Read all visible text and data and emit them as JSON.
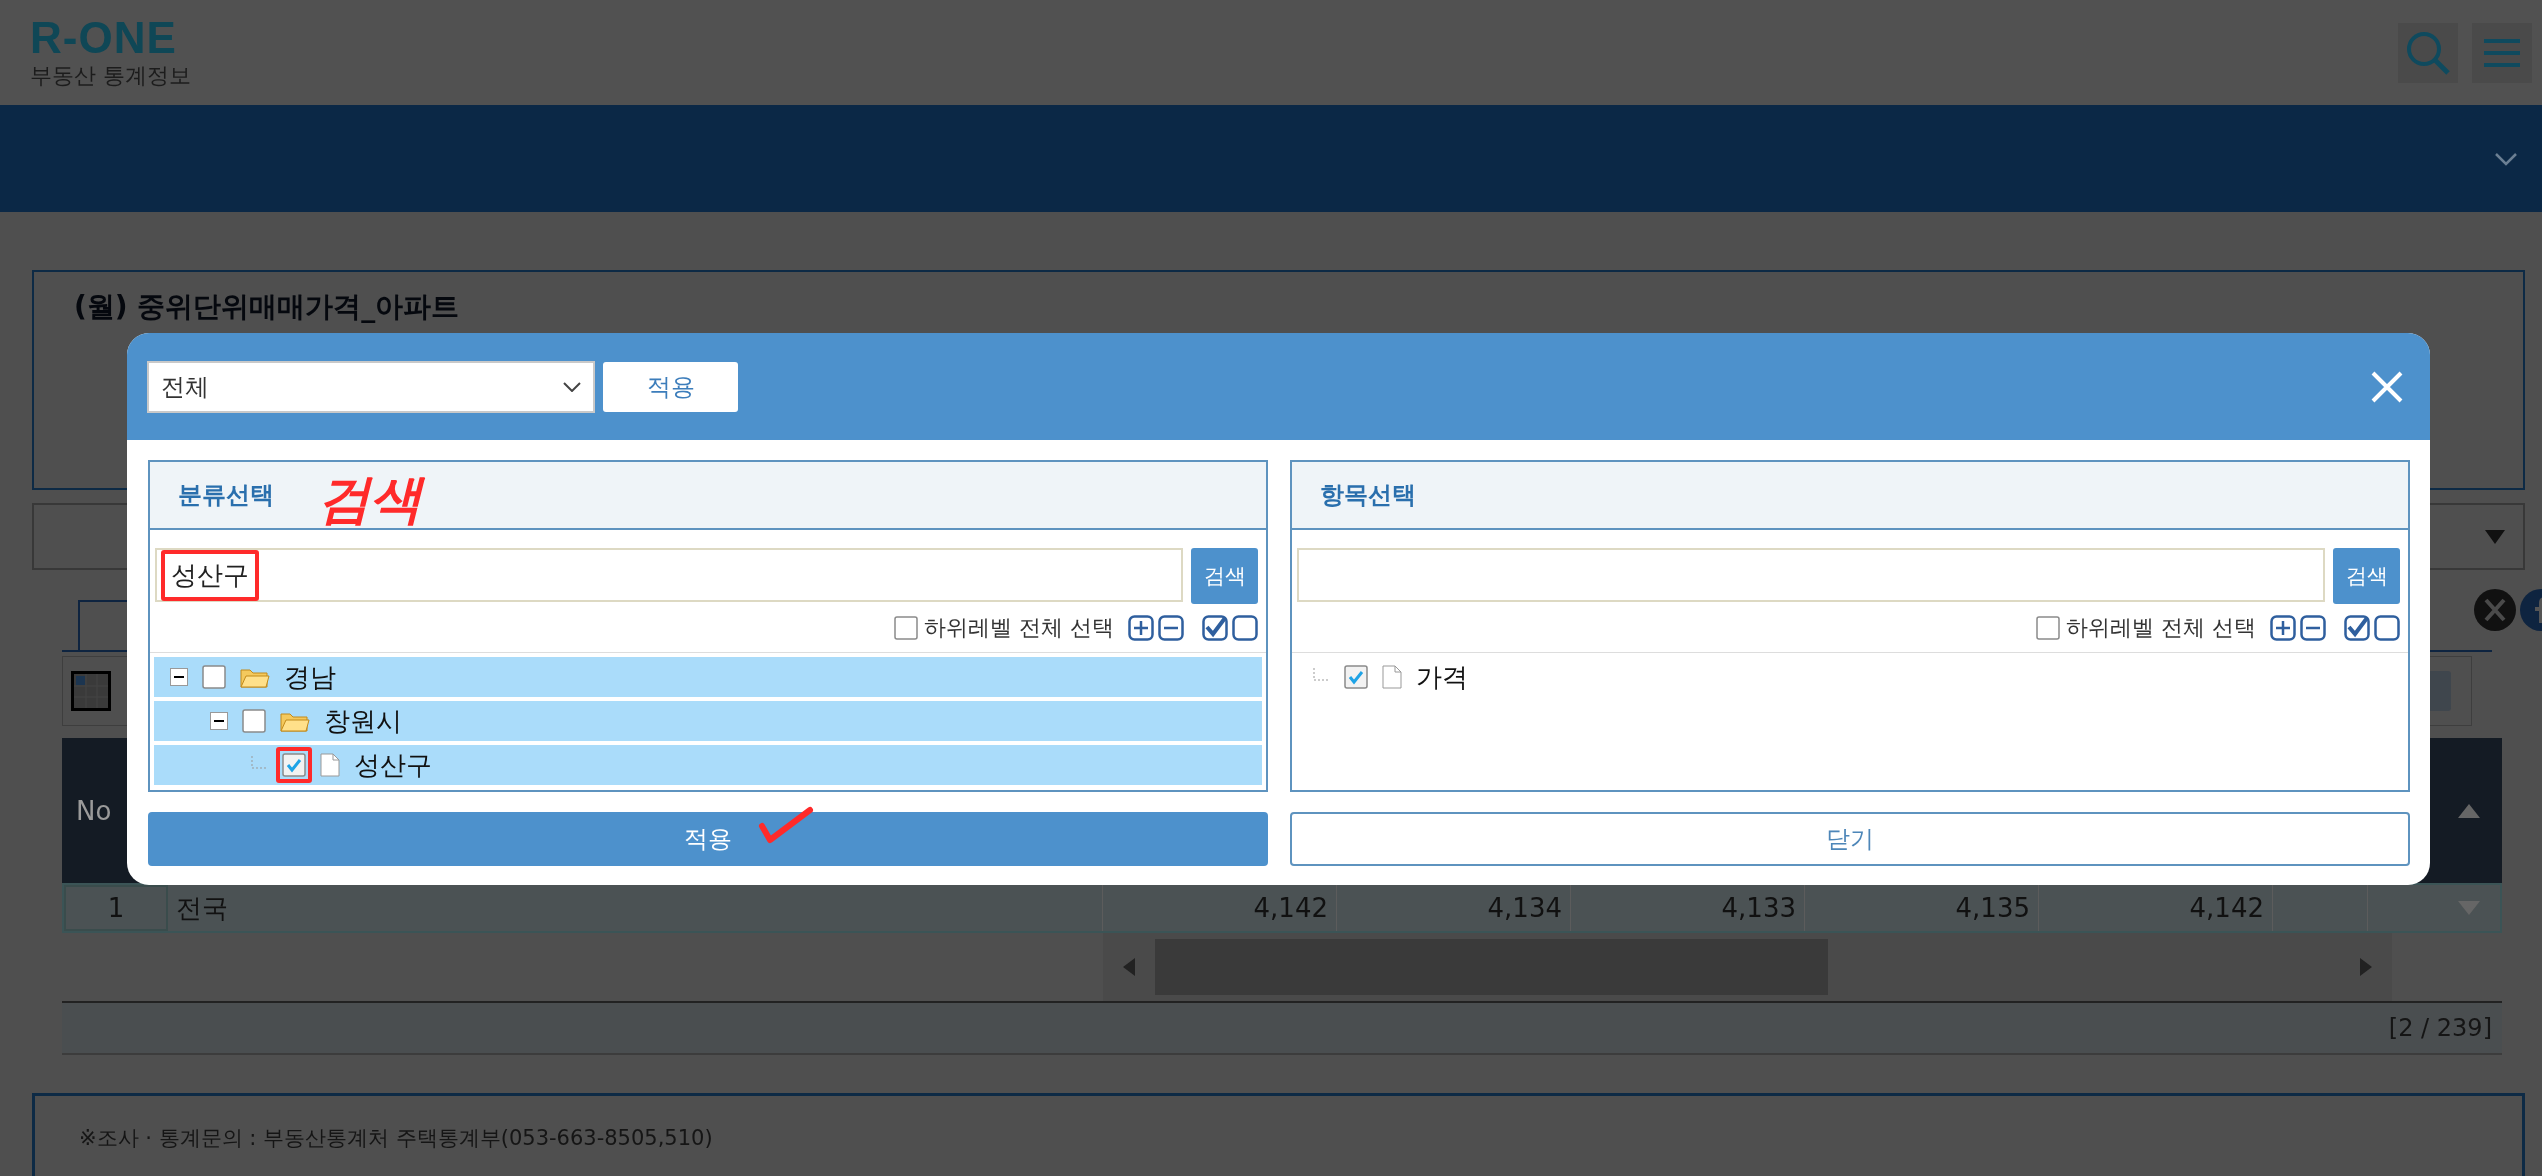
{
  "header": {
    "logo": "R-ONE",
    "subtitle": "부동산 통계정보"
  },
  "page": {
    "title": "(월) 중위단위매매가격_아파트",
    "table": {
      "header": "No",
      "rows": [
        {
          "no": "1",
          "region": "전국",
          "values": [
            "4,142",
            "4,134",
            "4,133",
            "4,135",
            "4,142"
          ]
        }
      ]
    },
    "pager": "[2 / 239]",
    "notice": "※조사 · 통계문의 : 부동산통계처 주택통계부(053-663-8505,510)"
  },
  "dialog": {
    "scope_select": {
      "value": "전체"
    },
    "scope_apply": "적용",
    "panels": [
      {
        "title": "분류선택",
        "annotation": "검색",
        "search": {
          "value": "성산구",
          "highlighted": true
        },
        "search_button": "검색",
        "select_all": {
          "label": "하위레벨 전체 선택",
          "checked": false
        },
        "tree": [
          {
            "label": "경남",
            "kind": "folder",
            "expanded": true,
            "checked": false,
            "selected": true,
            "highlighted": false,
            "children": [
              {
                "label": "창원시",
                "kind": "folder",
                "expanded": true,
                "checked": false,
                "selected": true,
                "highlighted": false,
                "children": [
                  {
                    "label": "성산구",
                    "kind": "file",
                    "checked": true,
                    "selected": true,
                    "highlighted": true
                  }
                ]
              }
            ]
          }
        ],
        "action": {
          "label": "적용",
          "kind": "primary",
          "annotated": true
        }
      },
      {
        "title": "항목선택",
        "search": {
          "highlighted": false
        },
        "search_button": "검색",
        "select_all": {
          "label": "하위레벨 전체 선택",
          "checked": false
        },
        "tree": [
          {
            "label": "가격",
            "kind": "file",
            "checked": true,
            "selected": false,
            "highlighted": false
          }
        ],
        "action": {
          "label": "닫기",
          "kind": "secondary",
          "annotated": false
        }
      }
    ]
  }
}
